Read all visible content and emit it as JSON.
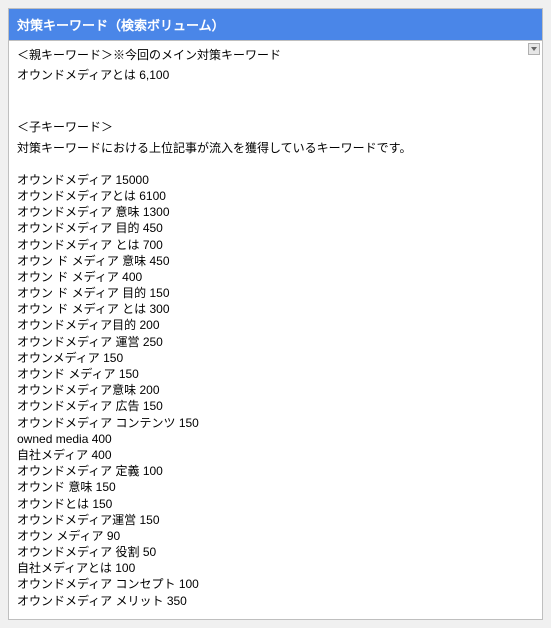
{
  "header": {
    "title": "対策キーワード（検索ボリューム）"
  },
  "parent": {
    "heading": "＜親キーワード＞※今回のメイン対策キーワード",
    "entry": "オウンドメディアとは 6,100"
  },
  "child": {
    "heading": "＜子キーワード＞",
    "description": "対策キーワードにおける上位記事が流入を獲得しているキーワードです。",
    "items": [
      "オウンドメディア 15000",
      "オウンドメディアとは 6100",
      "オウンドメディア 意味 1300",
      "オウンドメディア 目的 450",
      "オウンドメディア とは 700",
      "オウン ド メディア 意味 450",
      "オウン ド メディア 400",
      "オウン ド メディア 目的 150",
      "オウン ド メディア とは 300",
      "オウンドメディア目的 200",
      "オウンドメディア 運営 250",
      "オウンメディア 150",
      "オウンド メディア 150",
      "オウンドメディア意味 200",
      "オウンドメディア 広告 150",
      "オウンドメディア コンテンツ 150",
      "owned media 400",
      "自社メディア 400",
      "オウンドメディア 定義 100",
      "オウンド 意味 150",
      "オウンドとは 150",
      "オウンドメディア運営 150",
      "オウン メディア 90",
      "オウンドメディア 役割 50",
      "自社メディアとは 100",
      "オウンドメディア コンセプト 100",
      "オウンドメディア メリット 350"
    ]
  }
}
